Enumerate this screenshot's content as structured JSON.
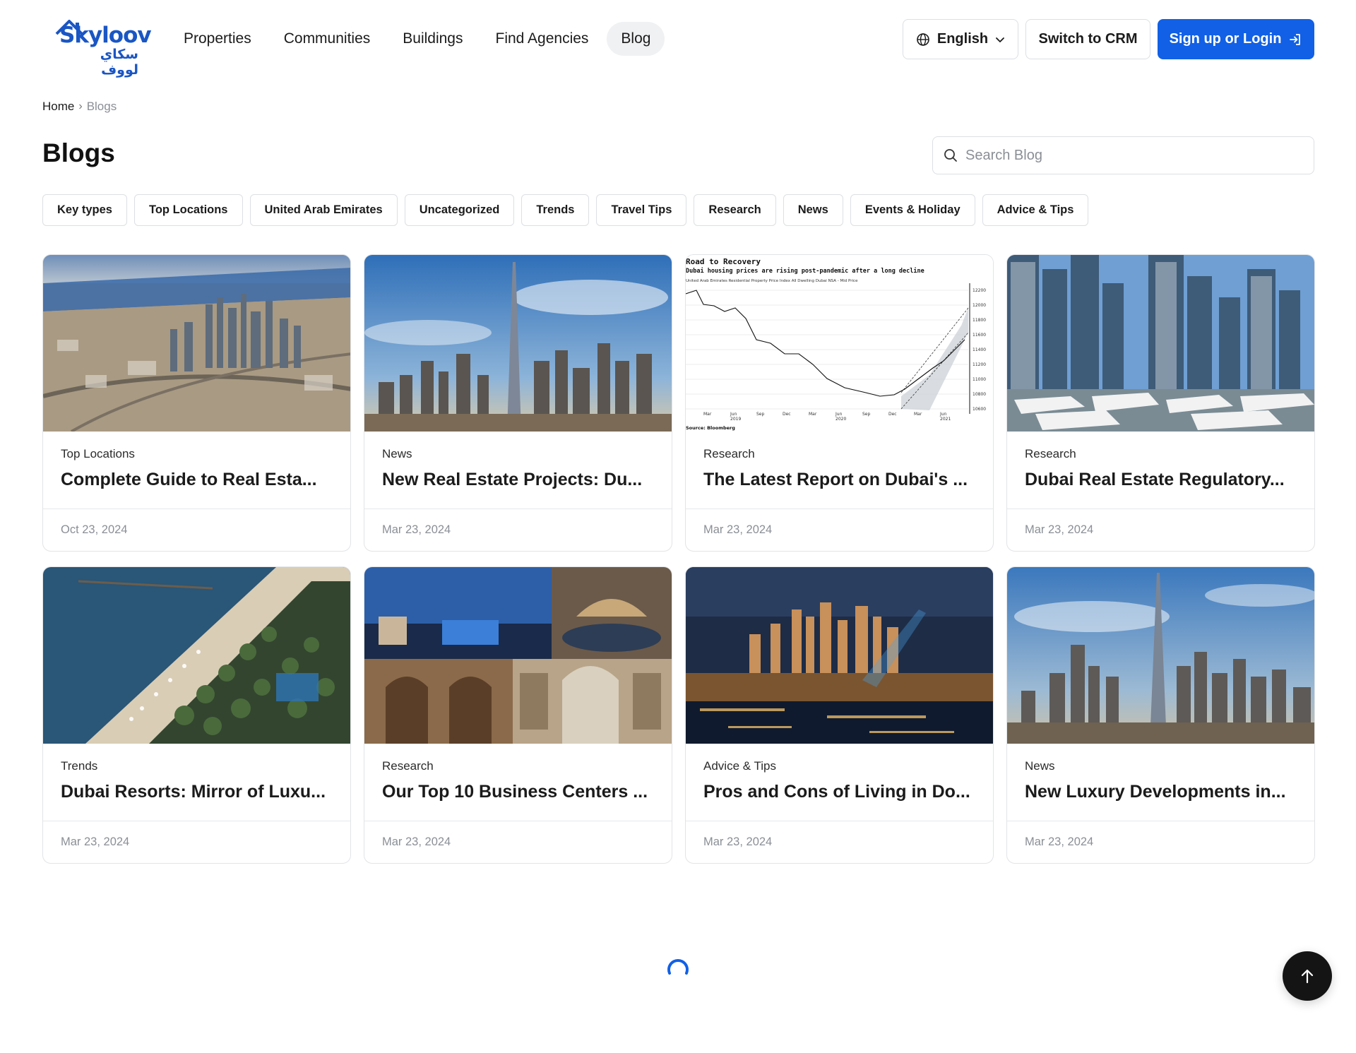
{
  "brand": {
    "name_en": "Skyloov",
    "name_ar": "سكاي لووف",
    "primary_color": "#1160e6"
  },
  "nav": {
    "items": [
      {
        "label": "Properties",
        "active": false
      },
      {
        "label": "Communities",
        "active": false
      },
      {
        "label": "Buildings",
        "active": false
      },
      {
        "label": "Find Agencies",
        "active": false
      },
      {
        "label": "Blog",
        "active": true
      }
    ]
  },
  "header": {
    "language_label": "English",
    "crm_label": "Switch to CRM",
    "login_label": "Sign up or Login"
  },
  "breadcrumb": {
    "home": "Home",
    "current": "Blogs"
  },
  "page": {
    "title": "Blogs",
    "search_placeholder": "Search Blog"
  },
  "categories": [
    "Key types",
    "Top Locations",
    "United Arab Emirates",
    "Uncategorized",
    "Trends",
    "Travel Tips",
    "Research",
    "News",
    "Events & Holiday",
    "Advice & Tips"
  ],
  "cards": [
    {
      "category": "Top Locations",
      "title": "Complete Guide to Real Esta...",
      "date": "Oct 23, 2024",
      "image": "aerial-city-photo"
    },
    {
      "category": "News",
      "title": "New Real Estate Projects: Du...",
      "date": "Mar 23, 2024",
      "image": "burj-skyline-photo"
    },
    {
      "category": "Research",
      "title": "The Latest Report on Dubai's ...",
      "date": "Mar 23, 2024",
      "image": "price-index-chart-image"
    },
    {
      "category": "Research",
      "title": "Dubai Real Estate Regulatory...",
      "date": "Mar 23, 2024",
      "image": "marina-yachts-photo"
    },
    {
      "category": "Trends",
      "title": "Dubai Resorts: Mirror of Luxu...",
      "date": "Mar 23, 2024",
      "image": "beach-resort-photo"
    },
    {
      "category": "Research",
      "title": "Our Top 10 Business Centers ...",
      "date": "Mar 23, 2024",
      "image": "malls-collage-photo"
    },
    {
      "category": "Advice & Tips",
      "title": "Pros and Cons of Living in Do...",
      "date": "Mar 23, 2024",
      "image": "downtown-night-photo"
    },
    {
      "category": "News",
      "title": "New Luxury Developments in...",
      "date": "Mar 23, 2024",
      "image": "downtown-skyline-photo"
    }
  ],
  "chart_image": {
    "title": "Road to Recovery",
    "subtitle": "Dubai housing prices are rising post-pandemic after a long decline",
    "legend": "United Arab Emirates Residential Property Price Index All Dwelling Dubai NSA - Mid Price",
    "source": "Source: Bloomberg",
    "y_ticks": [
      "12200",
      "12000",
      "11800",
      "11600",
      "11400",
      "11200",
      "11000",
      "10800",
      "10600"
    ],
    "x_ticks": [
      "Mar",
      "Jun\n2019",
      "Sep",
      "Dec",
      "Mar",
      "Jun\n2020",
      "Sep",
      "Dec",
      "Mar",
      "Jun\n2021"
    ]
  }
}
